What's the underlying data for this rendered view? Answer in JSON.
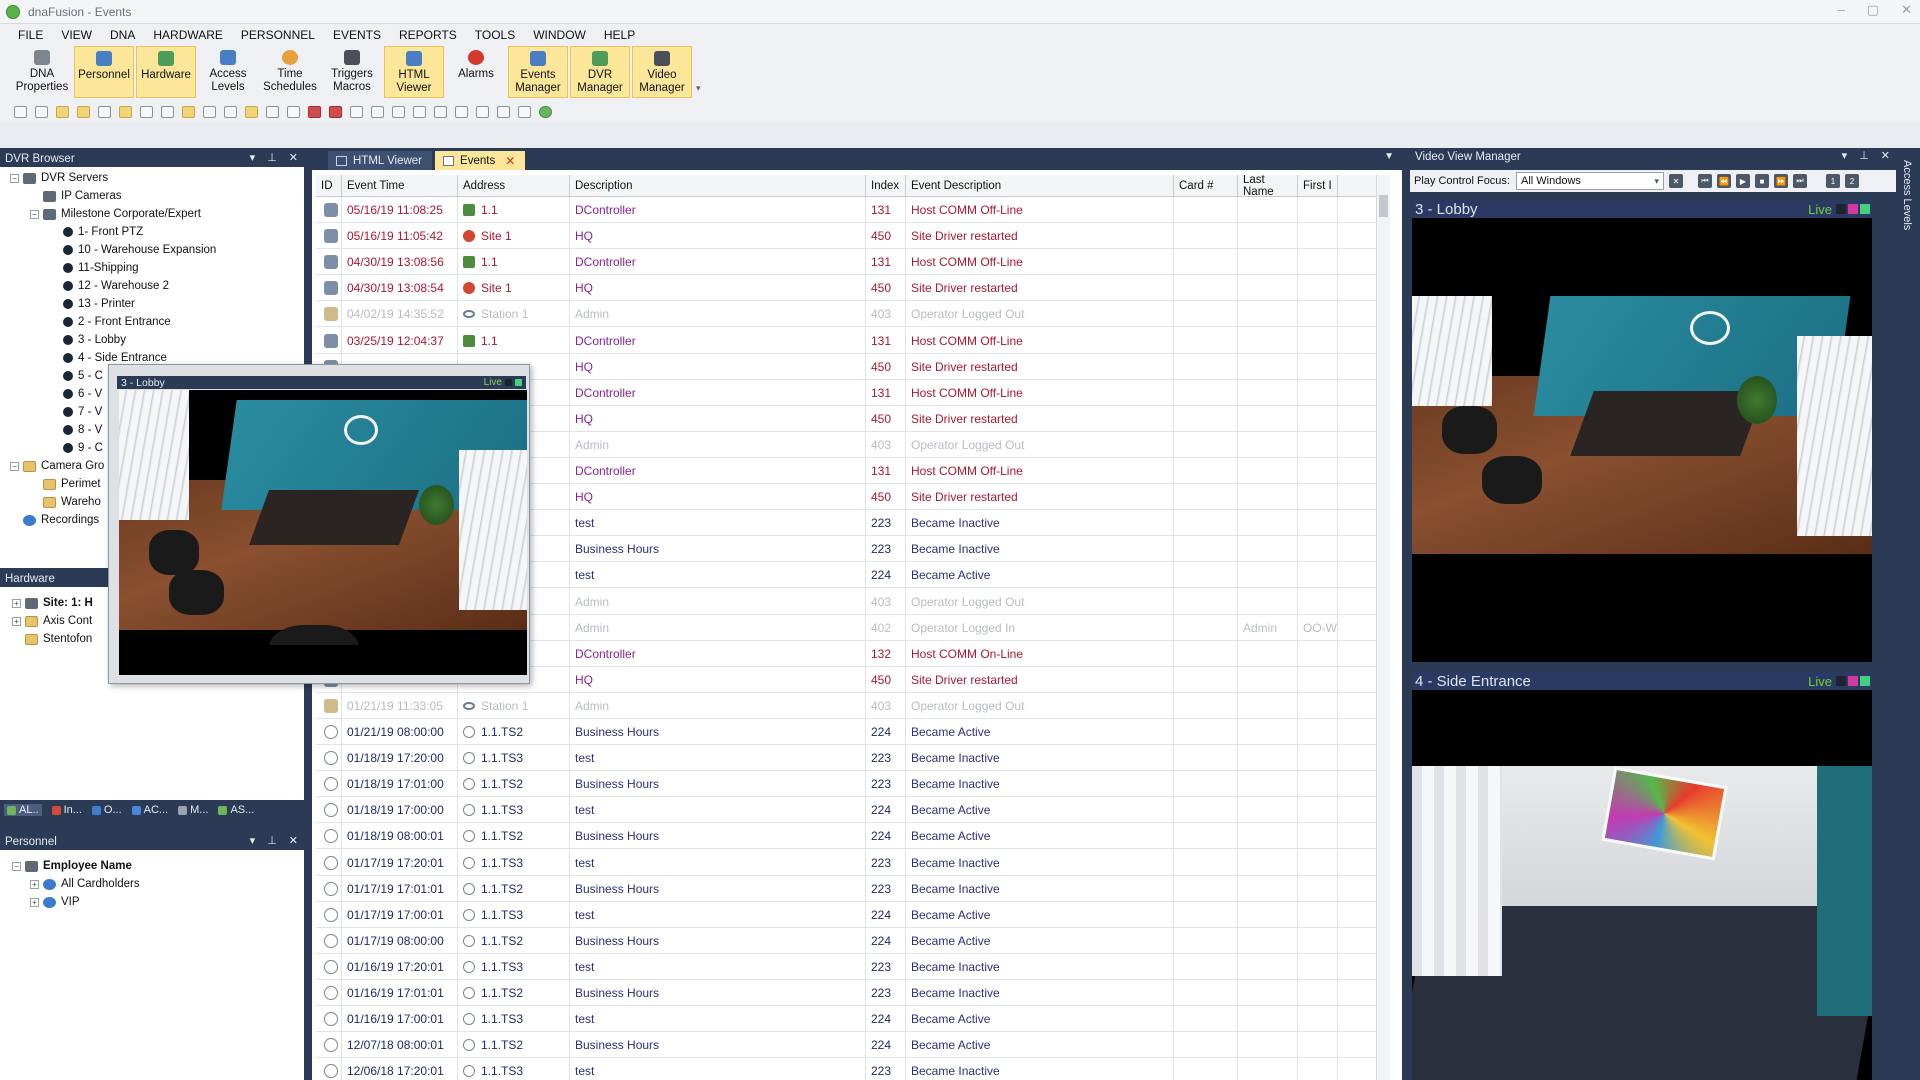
{
  "window": {
    "title": "dnaFusion - Events"
  },
  "menu": [
    "FILE",
    "VIEW",
    "DNA",
    "HARDWARE",
    "PERSONNEL",
    "EVENTS",
    "REPORTS",
    "TOOLS",
    "WINDOW",
    "HELP"
  ],
  "ribbon": [
    {
      "label": "DNA\nProperties",
      "icon": "gear-icon",
      "active": false
    },
    {
      "label": "Personnel",
      "icon": "person-icon",
      "active": true
    },
    {
      "label": "Hardware",
      "icon": "hardware-icon",
      "active": true
    },
    {
      "label": "Access\nLevels",
      "icon": "lock-icon",
      "active": false
    },
    {
      "label": "Time\nSchedules",
      "icon": "clock-icon",
      "active": false
    },
    {
      "label": "Triggers\nMacros",
      "icon": "trigger-icon",
      "active": false
    },
    {
      "label": "HTML\nViewer",
      "icon": "html-icon",
      "active": true
    },
    {
      "label": "Alarms",
      "icon": "alarm-icon",
      "active": false
    },
    {
      "label": "Events\nManager",
      "icon": "events-icon",
      "active": true
    },
    {
      "label": "DVR\nManager",
      "icon": "dvr-icon",
      "active": true
    },
    {
      "label": "Video\nManager",
      "icon": "video-icon",
      "active": true
    }
  ],
  "dvr_browser": {
    "title": "DVR Browser",
    "items": [
      {
        "label": "DVR Servers",
        "level": 0,
        "exp": "−",
        "icon": "server"
      },
      {
        "label": "IP Cameras",
        "level": 1,
        "exp": "",
        "icon": "server"
      },
      {
        "label": "Milestone Corporate/Expert",
        "level": 1,
        "exp": "−",
        "icon": "server"
      },
      {
        "label": "1- Front PTZ",
        "level": 2,
        "exp": "",
        "icon": "cam"
      },
      {
        "label": "10 - Warehouse Expansion",
        "level": 2,
        "exp": "",
        "icon": "cam"
      },
      {
        "label": "11-Shipping",
        "level": 2,
        "exp": "",
        "icon": "cam"
      },
      {
        "label": "12 - Warehouse 2",
        "level": 2,
        "exp": "",
        "icon": "cam"
      },
      {
        "label": "13 - Printer",
        "level": 2,
        "exp": "",
        "icon": "cam"
      },
      {
        "label": "2 - Front Entrance",
        "level": 2,
        "exp": "",
        "icon": "cam"
      },
      {
        "label": "3 - Lobby",
        "level": 2,
        "exp": "",
        "icon": "cam"
      },
      {
        "label": "4 - Side Entrance",
        "level": 2,
        "exp": "",
        "icon": "cam"
      },
      {
        "label": "5 - C",
        "level": 2,
        "exp": "",
        "icon": "cam"
      },
      {
        "label": "6 - V",
        "level": 2,
        "exp": "",
        "icon": "cam"
      },
      {
        "label": "7 - V",
        "level": 2,
        "exp": "",
        "icon": "cam"
      },
      {
        "label": "8 - V",
        "level": 2,
        "exp": "",
        "icon": "cam"
      },
      {
        "label": "9 - C",
        "level": 2,
        "exp": "",
        "icon": "cam"
      },
      {
        "label": "Camera Gro",
        "level": 0,
        "exp": "−",
        "icon": "folder"
      },
      {
        "label": "Perimet",
        "level": 1,
        "exp": "",
        "icon": "folder"
      },
      {
        "label": "Wareho",
        "level": 1,
        "exp": "",
        "icon": "folder"
      },
      {
        "label": "Recordings",
        "level": 0,
        "exp": "",
        "icon": "rec"
      }
    ]
  },
  "hardware": {
    "title": "Hardware",
    "items": [
      "Site: 1: H",
      "Axis Cont",
      "Stentofon"
    ],
    "tabs": [
      "AL..",
      "In...",
      "O...",
      "AC...",
      "M...",
      "AS..."
    ]
  },
  "personnel": {
    "title": "Personnel",
    "items": [
      "Employee Name",
      "All Cardholders",
      "VIP"
    ]
  },
  "tabs": [
    {
      "label": "HTML Viewer",
      "active": false
    },
    {
      "label": "Events",
      "active": true
    }
  ],
  "events": {
    "columns": [
      "ID",
      "Event Time",
      "Address",
      "Description",
      "Index",
      "Event Description",
      "Card #",
      "Last Name",
      "First I"
    ],
    "rows": [
      {
        "time": "05/16/19 11:08:25",
        "addr": "1.1",
        "ai": "green",
        "desc": "DController",
        "idx": "131",
        "ev": "Host COMM Off-Line",
        "last": "",
        "first": "",
        "c": "red"
      },
      {
        "time": "05/16/19 11:05:42",
        "addr": "Site 1",
        "ai": "red",
        "desc": "HQ",
        "idx": "450",
        "ev": "Site Driver restarted",
        "last": "",
        "first": "",
        "c": "red"
      },
      {
        "time": "04/30/19 13:08:56",
        "addr": "1.1",
        "ai": "green",
        "desc": "DController",
        "idx": "131",
        "ev": "Host COMM Off-Line",
        "last": "",
        "first": "",
        "c": "red"
      },
      {
        "time": "04/30/19 13:08:54",
        "addr": "Site 1",
        "ai": "red",
        "desc": "HQ",
        "idx": "450",
        "ev": "Site Driver restarted",
        "last": "",
        "first": "",
        "c": "red"
      },
      {
        "time": "04/02/19 14:35:52",
        "addr": "Station 1",
        "ai": "station",
        "desc": "Admin",
        "idx": "403",
        "ev": "Operator Logged Out",
        "last": "",
        "first": "",
        "c": "grey"
      },
      {
        "time": "03/25/19 12:04:37",
        "addr": "1.1",
        "ai": "green",
        "desc": "DController",
        "idx": "131",
        "ev": "Host COMM Off-Line",
        "last": "",
        "first": "",
        "c": "red"
      },
      {
        "time": "",
        "addr": "",
        "ai": "",
        "desc": "HQ",
        "idx": "450",
        "ev": "Site Driver restarted",
        "last": "",
        "first": "",
        "c": "red"
      },
      {
        "time": "",
        "addr": "",
        "ai": "",
        "desc": "DController",
        "idx": "131",
        "ev": "Host COMM Off-Line",
        "last": "",
        "first": "",
        "c": "red"
      },
      {
        "time": "",
        "addr": "",
        "ai": "",
        "desc": "HQ",
        "idx": "450",
        "ev": "Site Driver restarted",
        "last": "",
        "first": "",
        "c": "red"
      },
      {
        "time": "",
        "addr": "",
        "ai": "",
        "desc": "Admin",
        "idx": "403",
        "ev": "Operator Logged Out",
        "last": "",
        "first": "",
        "c": "grey"
      },
      {
        "time": "",
        "addr": "",
        "ai": "",
        "desc": "DController",
        "idx": "131",
        "ev": "Host COMM Off-Line",
        "last": "",
        "first": "",
        "c": "red"
      },
      {
        "time": "",
        "addr": "",
        "ai": "",
        "desc": "HQ",
        "idx": "450",
        "ev": "Site Driver restarted",
        "last": "",
        "first": "",
        "c": "red"
      },
      {
        "time": "",
        "addr": "",
        "ai": "",
        "desc": "test",
        "idx": "223",
        "ev": "Became Inactive",
        "last": "",
        "first": "",
        "c": "navy"
      },
      {
        "time": "",
        "addr": "",
        "ai": "",
        "desc": "Business Hours",
        "idx": "223",
        "ev": "Became Inactive",
        "last": "",
        "first": "",
        "c": "navy"
      },
      {
        "time": "",
        "addr": "",
        "ai": "",
        "desc": "test",
        "idx": "224",
        "ev": "Became Active",
        "last": "",
        "first": "",
        "c": "navy"
      },
      {
        "time": "",
        "addr": "",
        "ai": "",
        "desc": "Admin",
        "idx": "403",
        "ev": "Operator Logged Out",
        "last": "",
        "first": "",
        "c": "grey"
      },
      {
        "time": "",
        "addr": "",
        "ai": "",
        "desc": "Admin",
        "idx": "402",
        "ev": "Operator Logged In",
        "last": "Admin",
        "first": "OO-W",
        "c": "grey"
      },
      {
        "time": "",
        "addr": "",
        "ai": "",
        "desc": "DController",
        "idx": "132",
        "ev": "Host COMM On-Line",
        "last": "",
        "first": "",
        "c": "red"
      },
      {
        "time": "",
        "addr": "",
        "ai": "",
        "desc": "HQ",
        "idx": "450",
        "ev": "Site Driver restarted",
        "last": "",
        "first": "",
        "c": "red"
      },
      {
        "time": "01/21/19 11:33:05",
        "addr": "Station 1",
        "ai": "station",
        "desc": "Admin",
        "idx": "403",
        "ev": "Operator Logged Out",
        "last": "",
        "first": "",
        "c": "grey"
      },
      {
        "time": "01/21/19 08:00:00",
        "addr": "1.1.TS2",
        "ai": "clock",
        "desc": "Business Hours",
        "idx": "224",
        "ev": "Became Active",
        "last": "",
        "first": "",
        "c": "navy"
      },
      {
        "time": "01/18/19 17:20:00",
        "addr": "1.1.TS3",
        "ai": "clock",
        "desc": "test",
        "idx": "223",
        "ev": "Became Inactive",
        "last": "",
        "first": "",
        "c": "navy"
      },
      {
        "time": "01/18/19 17:01:00",
        "addr": "1.1.TS2",
        "ai": "clock",
        "desc": "Business Hours",
        "idx": "223",
        "ev": "Became Inactive",
        "last": "",
        "first": "",
        "c": "navy"
      },
      {
        "time": "01/18/19 17:00:00",
        "addr": "1.1.TS3",
        "ai": "clock",
        "desc": "test",
        "idx": "224",
        "ev": "Became Active",
        "last": "",
        "first": "",
        "c": "navy"
      },
      {
        "time": "01/18/19 08:00:01",
        "addr": "1.1.TS2",
        "ai": "clock",
        "desc": "Business Hours",
        "idx": "224",
        "ev": "Became Active",
        "last": "",
        "first": "",
        "c": "navy"
      },
      {
        "time": "01/17/19 17:20:01",
        "addr": "1.1.TS3",
        "ai": "clock",
        "desc": "test",
        "idx": "223",
        "ev": "Became Inactive",
        "last": "",
        "first": "",
        "c": "navy"
      },
      {
        "time": "01/17/19 17:01:01",
        "addr": "1.1.TS2",
        "ai": "clock",
        "desc": "Business Hours",
        "idx": "223",
        "ev": "Became Inactive",
        "last": "",
        "first": "",
        "c": "navy"
      },
      {
        "time": "01/17/19 17:00:01",
        "addr": "1.1.TS3",
        "ai": "clock",
        "desc": "test",
        "idx": "224",
        "ev": "Became Active",
        "last": "",
        "first": "",
        "c": "navy"
      },
      {
        "time": "01/17/19 08:00:00",
        "addr": "1.1.TS2",
        "ai": "clock",
        "desc": "Business Hours",
        "idx": "224",
        "ev": "Became Active",
        "last": "",
        "first": "",
        "c": "navy"
      },
      {
        "time": "01/16/19 17:20:01",
        "addr": "1.1.TS3",
        "ai": "clock",
        "desc": "test",
        "idx": "223",
        "ev": "Became Inactive",
        "last": "",
        "first": "",
        "c": "navy"
      },
      {
        "time": "01/16/19 17:01:01",
        "addr": "1.1.TS2",
        "ai": "clock",
        "desc": "Business Hours",
        "idx": "223",
        "ev": "Became Inactive",
        "last": "",
        "first": "",
        "c": "navy"
      },
      {
        "time": "01/16/19 17:00:01",
        "addr": "1.1.TS3",
        "ai": "clock",
        "desc": "test",
        "idx": "224",
        "ev": "Became Active",
        "last": "",
        "first": "",
        "c": "navy"
      },
      {
        "time": "12/07/18 08:00:01",
        "addr": "1.1.TS2",
        "ai": "clock",
        "desc": "Business Hours",
        "idx": "224",
        "ev": "Became Active",
        "last": "",
        "first": "",
        "c": "navy"
      },
      {
        "time": "12/06/18 17:20:01",
        "addr": "1.1.TS3",
        "ai": "clock",
        "desc": "test",
        "idx": "223",
        "ev": "Became Inactive",
        "last": "",
        "first": "",
        "c": "navy"
      }
    ]
  },
  "popup": {
    "title": "3 - Lobby",
    "live": "Live"
  },
  "video_manager": {
    "title": "Video View Manager",
    "focus_label": "Play Control Focus:",
    "focus_value": "All Windows",
    "side_tab": "Access Levels",
    "tiles": [
      {
        "title": "3 - Lobby",
        "live": "Live"
      },
      {
        "title": "4 - Side Entrance",
        "live": "Live"
      }
    ]
  },
  "colors": {
    "panel_header": "#2c3b55",
    "active_tab": "#fbe69a",
    "alarm_red": "#b0162e",
    "schedule_navy": "#1c2775"
  }
}
